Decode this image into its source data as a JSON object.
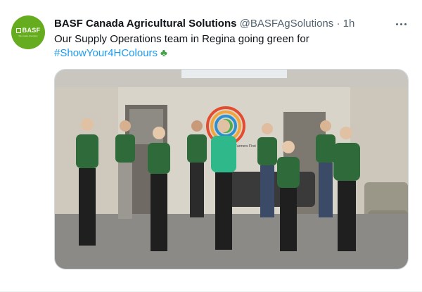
{
  "tweet": {
    "author_name": "BASF Canada Agricultural Solutions",
    "handle": "@BASFAgSolutions",
    "separator": "·",
    "time": "1h",
    "text": "Our Supply Operations team in Regina going green for",
    "hashtag": "#ShowYour4HColours",
    "emoji_name": "four-leaf-clover-icon",
    "more_icon": "more-horizontal-icon"
  },
  "avatar": {
    "logo_text": "BASF",
    "tagline": "We create chemistry",
    "color": "#65ac1e"
  },
  "photo": {
    "wall_sign": "Farmers First",
    "description_colors": {
      "shirt_green": "#2f6b3a",
      "mint_shirt": "#2fb88a",
      "carpet": "#8c8a86",
      "wall": "#d9d4c9"
    }
  },
  "colors": {
    "link": "#1d9bf0",
    "secondary_text": "#536471"
  }
}
